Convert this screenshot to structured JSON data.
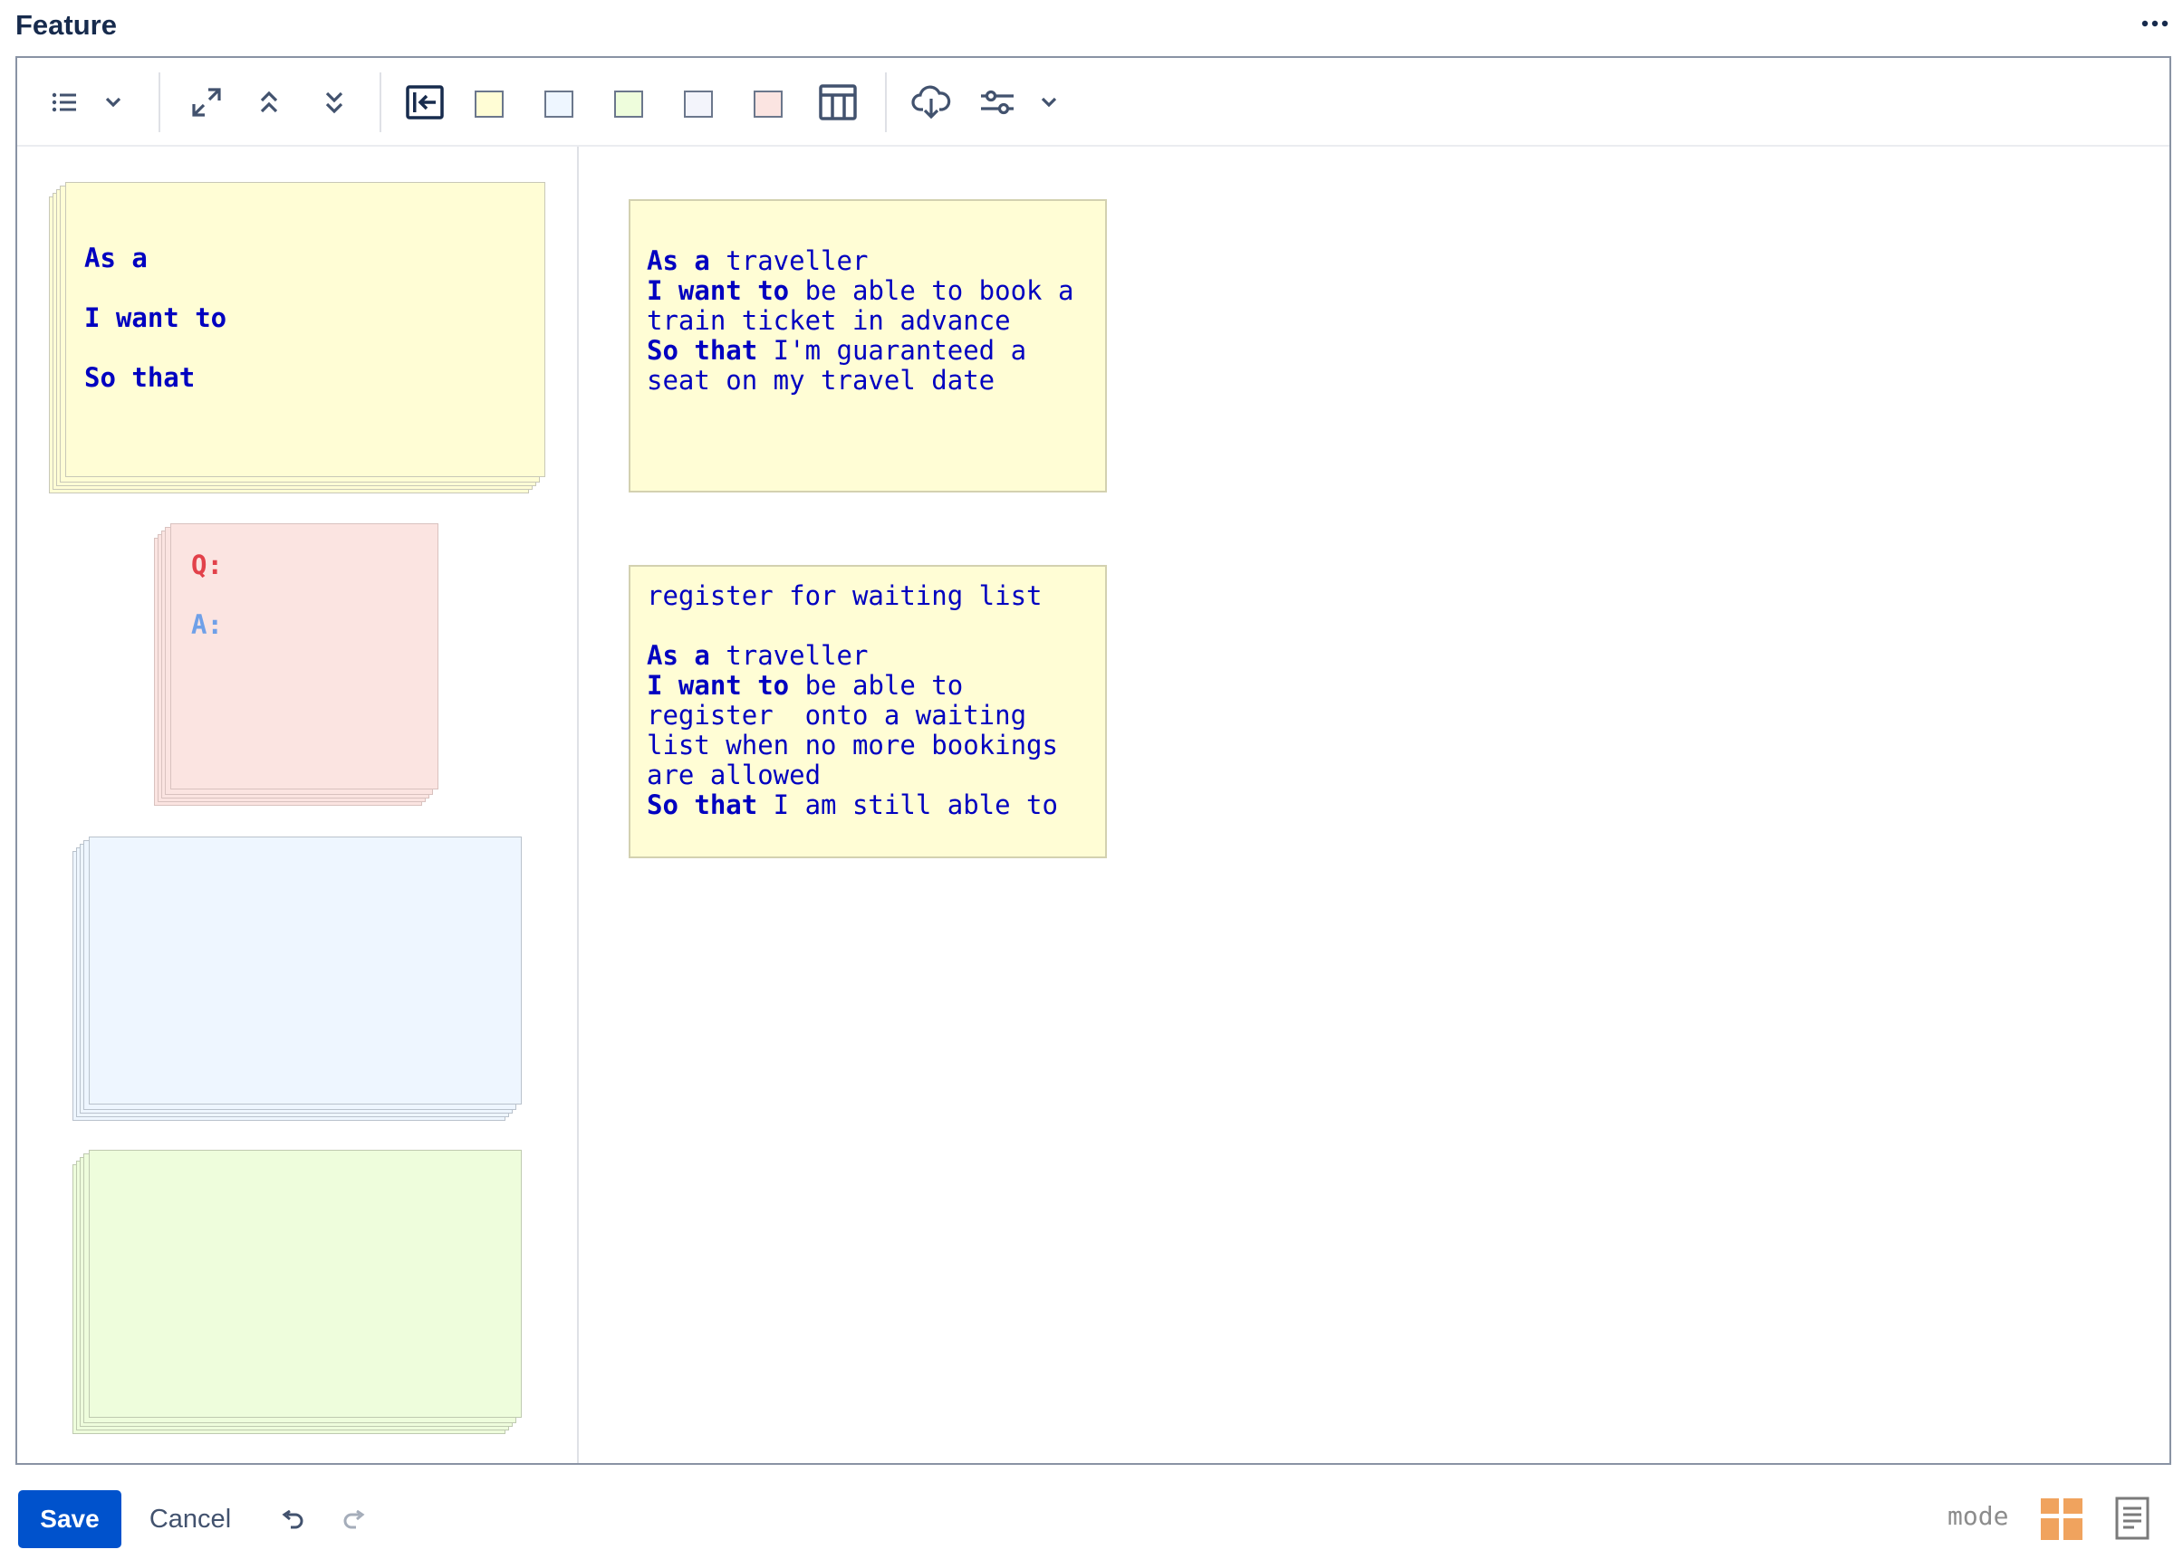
{
  "header": {
    "title": "Feature",
    "more_icon": "more-horizontal-icon"
  },
  "toolbar": {
    "icons": [
      "list-icon",
      "chevron-down-icon",
      "expand-icon",
      "collapse-up-icon",
      "collapse-down-icon",
      "exit-left-icon",
      "table-icon",
      "cloud-download-icon",
      "sliders-icon",
      "chevron-down-icon"
    ],
    "swatches": [
      {
        "name": "yellow",
        "color": "#fffdd5"
      },
      {
        "name": "blue",
        "color": "#eef6ff"
      },
      {
        "name": "green",
        "color": "#eefddc"
      },
      {
        "name": "lavender",
        "color": "#f3f4fb"
      },
      {
        "name": "pink",
        "color": "#fbe4e1"
      }
    ]
  },
  "palette": {
    "story_template": {
      "line1": "As a",
      "line2": "I want to",
      "line3": "So that",
      "color": "#fffdd5"
    },
    "qa_template": {
      "q": "Q:",
      "a": "A:",
      "color": "#fbe4e1"
    },
    "blue_card": {
      "color": "#eef6ff"
    },
    "green_card": {
      "color": "#eefddc"
    }
  },
  "board": {
    "sticky1": {
      "l1a": "As a",
      "l1b": " traveller",
      "l2a": "I want to",
      "l2b": " be able to book a",
      "l3": "train ticket in advance",
      "l4a": "So that",
      "l4b": " I'm guaranteed a",
      "l5": "seat on my travel date"
    },
    "sticky2": {
      "title": "register for waiting list",
      "l1a": "As a",
      "l1b": " traveller",
      "l2a": "I want to",
      "l2b": " be able to",
      "l3": "register  onto a waiting",
      "l4": "list when no more bookings",
      "l5": "are allowed",
      "l6a": "So that",
      "l6b": " I am still able to"
    }
  },
  "footer": {
    "save_label": "Save",
    "cancel_label": "Cancel",
    "mode_label": "mode",
    "colors": {
      "primary": "#0052cc",
      "mode_accent": "#f0a35e"
    }
  }
}
